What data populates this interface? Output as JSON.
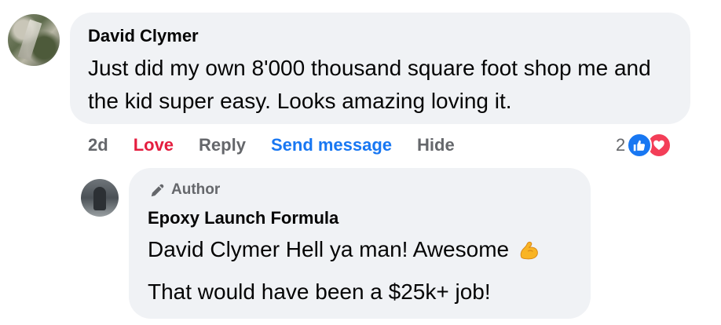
{
  "comment": {
    "author": "David Clymer",
    "text": "Just did my own 8'000 thousand square foot shop me and the kid super easy. Looks amazing loving it.",
    "actions": {
      "time": "2d",
      "love": "Love",
      "reply": "Reply",
      "send_message": "Send message",
      "hide": "Hide"
    },
    "reactions": {
      "count": "2",
      "icons": [
        "like-icon",
        "love-icon"
      ]
    }
  },
  "reply": {
    "badge": "Author",
    "author": "Epoxy Launch Formula",
    "line1": "David Clymer Hell ya man! Awesome",
    "line2": "That would have been a $25k+ job!",
    "emoji": "flexed-biceps-icon"
  },
  "colors": {
    "bubble": "#f0f2f5",
    "love": "#e41e3f",
    "link": "#1877f2",
    "muted": "#65676b",
    "like": "#1877f2",
    "heart": "#f33e58"
  }
}
